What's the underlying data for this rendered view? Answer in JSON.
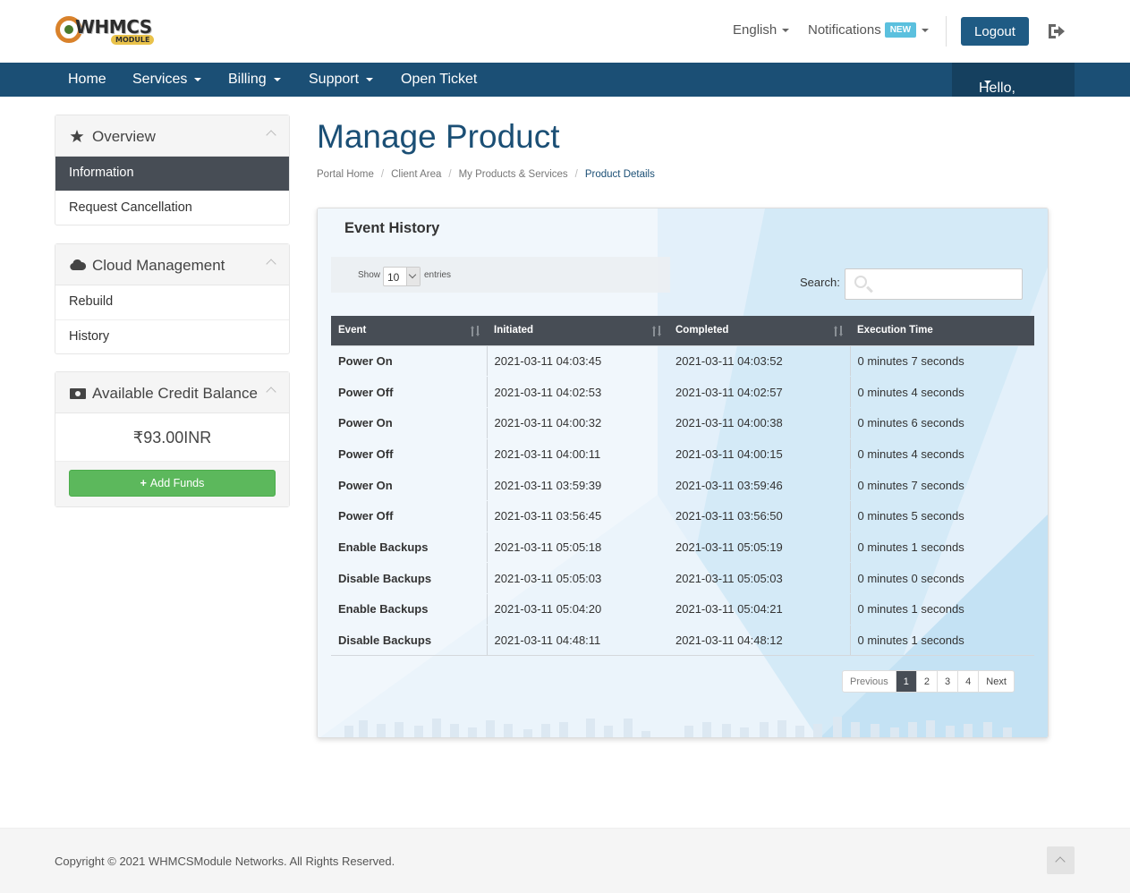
{
  "header": {
    "logo_text": "WHMCS",
    "logo_sub": "MODULE",
    "language": "English",
    "notifications": "Notifications",
    "notifications_badge": "NEW",
    "logout": "Logout"
  },
  "nav": {
    "items": [
      "Home",
      "Services",
      "Billing",
      "Support",
      "Open Ticket"
    ],
    "user": "Hello, Demo!"
  },
  "sidebar": {
    "overview": {
      "title": "Overview",
      "items": [
        "Information",
        "Request Cancellation"
      ]
    },
    "cloud": {
      "title": "Cloud Management",
      "items": [
        "Rebuild",
        "History"
      ]
    },
    "credit": {
      "title": "Available Credit Balance",
      "value": "₹93.00INR",
      "button": "Add Funds"
    }
  },
  "main": {
    "title": "Manage Product",
    "breadcrumb": [
      "Portal Home",
      "Client Area",
      "My Products & Services",
      "Product Details"
    ],
    "card_title": "Event History",
    "show_label": "Show",
    "entries_value": "10",
    "entries_label": "entries",
    "search_label": "Search:",
    "columns": [
      "Event",
      "Initiated",
      "Completed",
      "Execution Time"
    ],
    "rows": [
      [
        "Power On",
        "2021-03-11 04:03:45",
        "2021-03-11 04:03:52",
        "0 minutes 7 seconds"
      ],
      [
        "Power Off",
        "2021-03-11 04:02:53",
        "2021-03-11 04:02:57",
        "0 minutes 4 seconds"
      ],
      [
        "Power On",
        "2021-03-11 04:00:32",
        "2021-03-11 04:00:38",
        "0 minutes 6 seconds"
      ],
      [
        "Power Off",
        "2021-03-11 04:00:11",
        "2021-03-11 04:00:15",
        "0 minutes 4 seconds"
      ],
      [
        "Power On",
        "2021-03-11 03:59:39",
        "2021-03-11 03:59:46",
        "0 minutes 7 seconds"
      ],
      [
        "Power Off",
        "2021-03-11 03:56:45",
        "2021-03-11 03:56:50",
        "0 minutes 5 seconds"
      ],
      [
        "Enable Backups",
        "2021-03-11 05:05:18",
        "2021-03-11 05:05:19",
        "0 minutes 1 seconds"
      ],
      [
        "Disable Backups",
        "2021-03-11 05:05:03",
        "2021-03-11 05:05:03",
        "0 minutes 0 seconds"
      ],
      [
        "Enable Backups",
        "2021-03-11 05:04:20",
        "2021-03-11 05:04:21",
        "0 minutes 1 seconds"
      ],
      [
        "Disable Backups",
        "2021-03-11 04:48:11",
        "2021-03-11 04:48:12",
        "0 minutes 1 seconds"
      ]
    ],
    "pager": [
      "Previous",
      "1",
      "2",
      "3",
      "4",
      "Next"
    ],
    "pager_active": "1"
  },
  "footer": {
    "copyright": "Copyright © 2021 WHMCSModule Networks. All Rights Reserved."
  },
  "colors": {
    "brand": "#1b4f75",
    "sidebar_active": "#474d55",
    "success": "#5cb85c",
    "badge": "#5bc0de"
  }
}
